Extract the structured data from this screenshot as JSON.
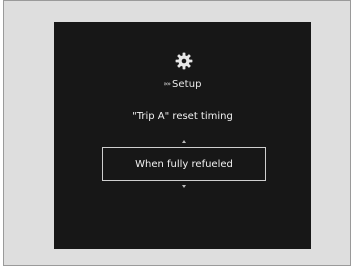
{
  "setup": {
    "icon": "gear-icon",
    "chevrons": "»»",
    "title": "Setup"
  },
  "setting": {
    "title": "\"Trip A\" reset timing",
    "selected_option": "When fully refueled"
  }
}
